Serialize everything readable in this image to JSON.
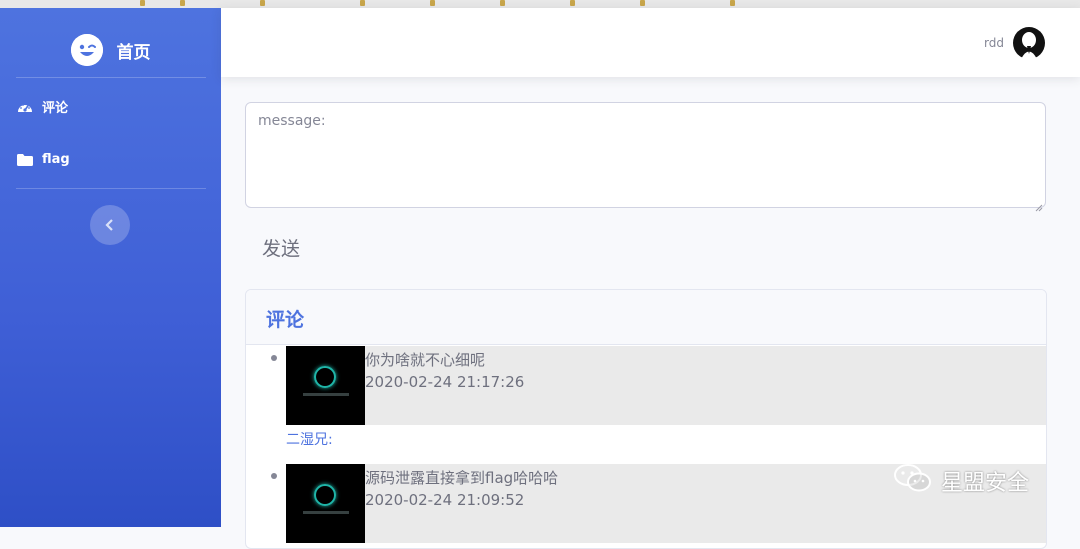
{
  "sidebar": {
    "brand": {
      "label": "首页",
      "icon": "laugh-wink-icon"
    },
    "items": [
      {
        "label": "评论",
        "icon": "tachometer-icon"
      },
      {
        "label": "flag",
        "icon": "folder-icon"
      }
    ],
    "toggle_icon": "chevron-left-icon"
  },
  "topbar": {
    "username": "rdd",
    "avatar_icon": "user-avatar-icon"
  },
  "message_form": {
    "placeholder": "message:",
    "value": "",
    "send_label": "发送"
  },
  "comments_card": {
    "title": "评论",
    "comments": [
      {
        "text": "你为啥就不心细呢",
        "time": "2020-02-24 21:17:26",
        "author": "二湿兄:"
      },
      {
        "text": "源码泄露直接拿到flag哈哈哈",
        "time": "2020-02-24 21:09:52"
      }
    ]
  },
  "watermark": {
    "text": "星盟安全",
    "icon": "wechat-icon"
  },
  "colors": {
    "primary": "#4e73df",
    "sidebar_dark": "#2e4fc6",
    "text_muted": "#858796"
  }
}
